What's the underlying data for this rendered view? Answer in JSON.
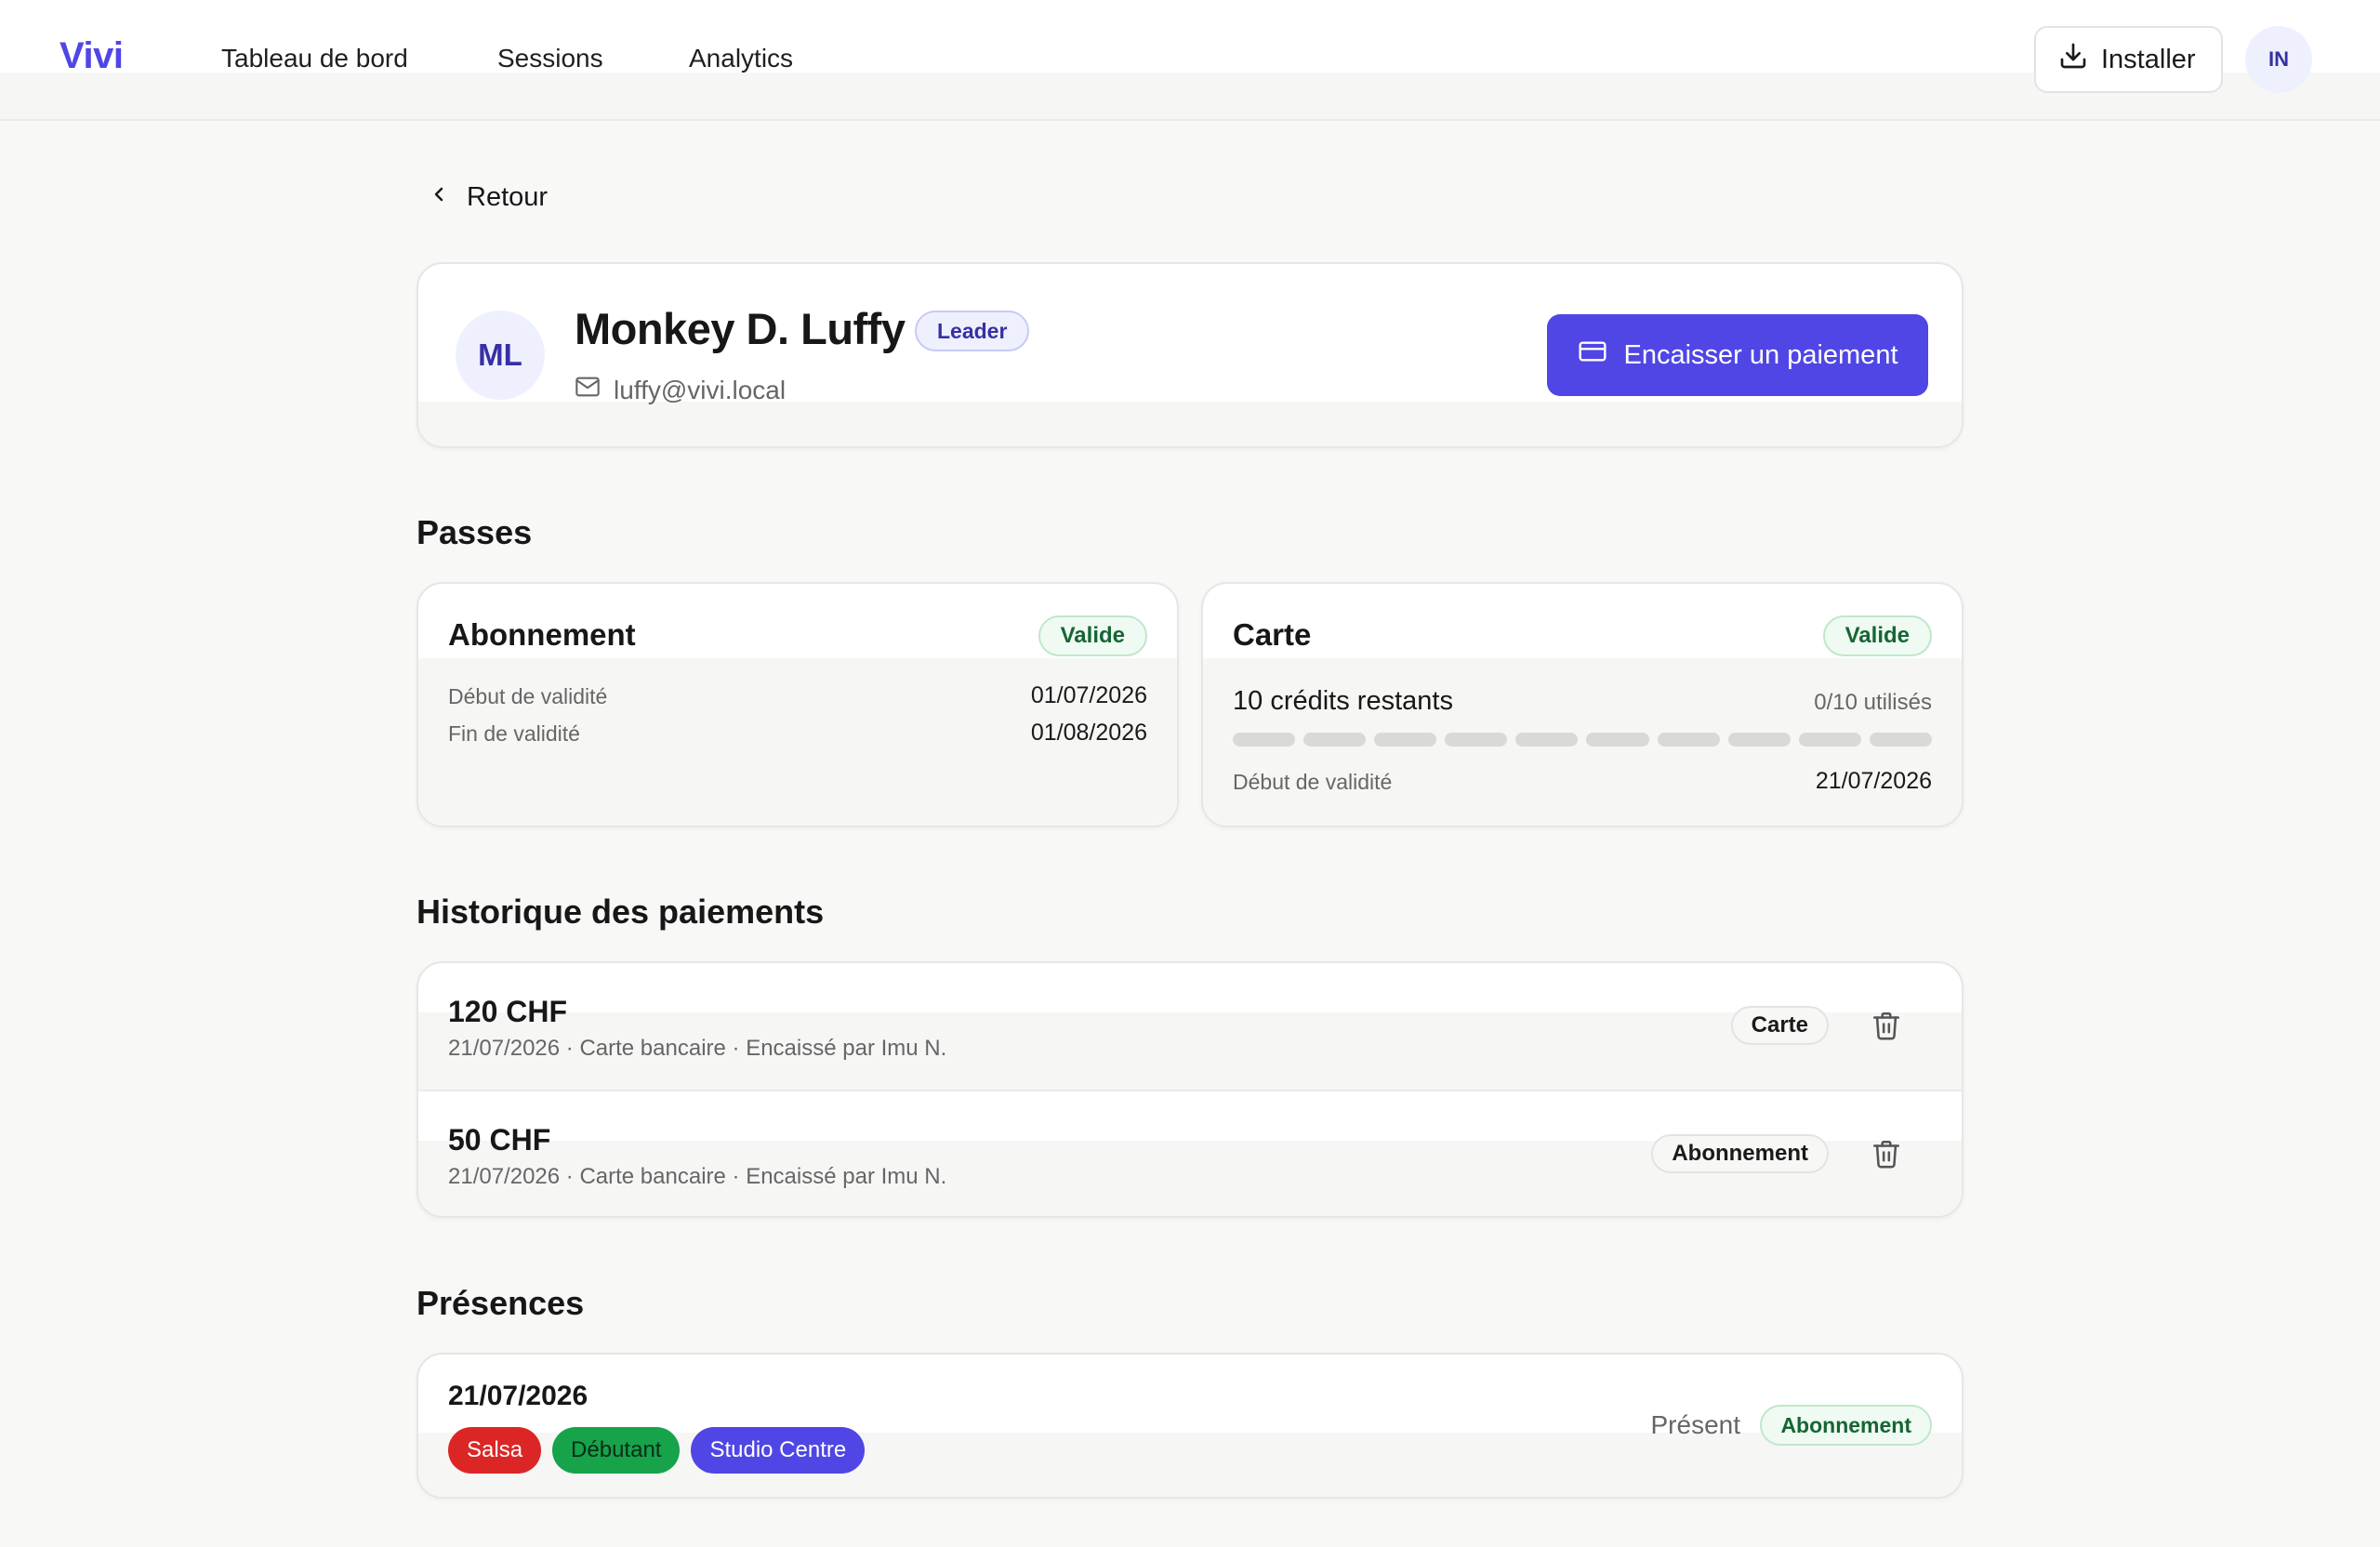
{
  "app": {
    "brand": "Vivi"
  },
  "nav": {
    "items": [
      {
        "label": "Tableau de bord"
      },
      {
        "label": "Sessions"
      },
      {
        "label": "Analytics"
      }
    ],
    "install_label": "Installer",
    "user_initials": "IN"
  },
  "back_label": "Retour",
  "profile": {
    "initials": "ML",
    "name": "Monkey D. Luffy",
    "role": "Leader",
    "email": "luffy@vivi.local",
    "pay_button": "Encaisser un paiement"
  },
  "passes": {
    "title": "Passes",
    "subscription": {
      "title": "Abonnement",
      "status": "Valide",
      "start_label": "Début de validité",
      "start_value": "01/07/2026",
      "end_label": "Fin de validité",
      "end_value": "01/08/2026"
    },
    "card": {
      "title": "Carte",
      "status": "Valide",
      "credits_text": "10 crédits restants",
      "usage_text": "0/10 utilisés",
      "credits_used": 0,
      "credits_total": 10,
      "start_label": "Début de validité",
      "start_value": "21/07/2026"
    }
  },
  "payments": {
    "title": "Historique des paiements",
    "rows": [
      {
        "amount": "120 CHF",
        "meta": "21/07/2026 · Carte bancaire · Encaissé par Imu N.",
        "type": "Carte"
      },
      {
        "amount": "50 CHF",
        "meta": "21/07/2026 · Carte bancaire · Encaissé par Imu N.",
        "type": "Abonnement"
      }
    ]
  },
  "attendance": {
    "title": "Présences",
    "rows": [
      {
        "date": "21/07/2026",
        "tags": [
          {
            "label": "Salsa",
            "color": "#dc2626"
          },
          {
            "label": "Débutant",
            "color": "#16a34a"
          },
          {
            "label": "Studio Centre",
            "color": "#4f46e5"
          }
        ],
        "status": "Présent",
        "pass_type": "Abonnement"
      }
    ]
  },
  "colors": {
    "accent": "#4f46e5",
    "success": "#166534",
    "background": "#f8f8f7"
  }
}
